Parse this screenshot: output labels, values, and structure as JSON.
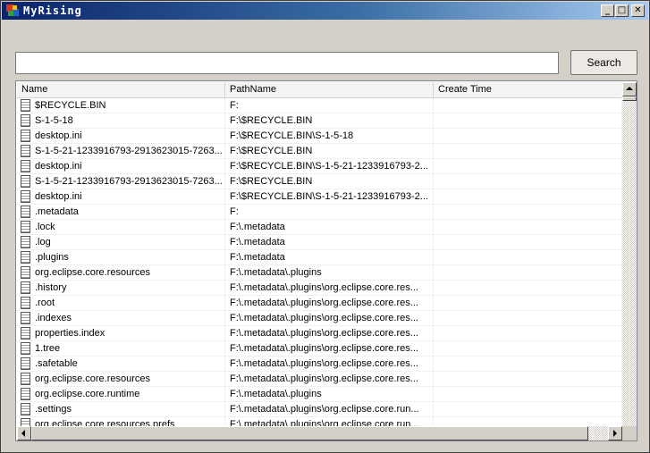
{
  "window": {
    "title": "MyRising",
    "controls": [
      "_",
      "□",
      "✕"
    ]
  },
  "search": {
    "value": "",
    "placeholder": "",
    "button_label": "Search"
  },
  "table": {
    "columns": [
      "Name",
      "PathName",
      "Create Time"
    ],
    "rows": [
      {
        "name": "$RECYCLE.BIN",
        "path": "F:",
        "time": ""
      },
      {
        "name": "S-1-5-18",
        "path": "F:\\$RECYCLE.BIN",
        "time": ""
      },
      {
        "name": "desktop.ini",
        "path": "F:\\$RECYCLE.BIN\\S-1-5-18",
        "time": ""
      },
      {
        "name": "S-1-5-21-1233916793-2913623015-7263...",
        "path": "F:\\$RECYCLE.BIN",
        "time": ""
      },
      {
        "name": "desktop.ini",
        "path": "F:\\$RECYCLE.BIN\\S-1-5-21-1233916793-2...",
        "time": ""
      },
      {
        "name": "S-1-5-21-1233916793-2913623015-7263...",
        "path": "F:\\$RECYCLE.BIN",
        "time": ""
      },
      {
        "name": "desktop.ini",
        "path": "F:\\$RECYCLE.BIN\\S-1-5-21-1233916793-2...",
        "time": ""
      },
      {
        "name": ".metadata",
        "path": "F:",
        "time": ""
      },
      {
        "name": ".lock",
        "path": "F:\\.metadata",
        "time": ""
      },
      {
        "name": ".log",
        "path": "F:\\.metadata",
        "time": ""
      },
      {
        "name": ".plugins",
        "path": "F:\\.metadata",
        "time": ""
      },
      {
        "name": "org.eclipse.core.resources",
        "path": "F:\\.metadata\\.plugins",
        "time": ""
      },
      {
        "name": ".history",
        "path": "F:\\.metadata\\.plugins\\org.eclipse.core.res...",
        "time": ""
      },
      {
        "name": ".root",
        "path": "F:\\.metadata\\.plugins\\org.eclipse.core.res...",
        "time": ""
      },
      {
        "name": ".indexes",
        "path": "F:\\.metadata\\.plugins\\org.eclipse.core.res...",
        "time": ""
      },
      {
        "name": "properties.index",
        "path": "F:\\.metadata\\.plugins\\org.eclipse.core.res...",
        "time": ""
      },
      {
        "name": "1.tree",
        "path": "F:\\.metadata\\.plugins\\org.eclipse.core.res...",
        "time": ""
      },
      {
        "name": ".safetable",
        "path": "F:\\.metadata\\.plugins\\org.eclipse.core.res...",
        "time": ""
      },
      {
        "name": "org.eclipse.core.resources",
        "path": "F:\\.metadata\\.plugins\\org.eclipse.core.res...",
        "time": ""
      },
      {
        "name": "org.eclipse.core.runtime",
        "path": "F:\\.metadata\\.plugins",
        "time": ""
      },
      {
        "name": ".settings",
        "path": "F:\\.metadata\\.plugins\\org.eclipse.core.run...",
        "time": ""
      },
      {
        "name": "org.eclipse.core.resources.prefs",
        "path": "F:\\.metadata\\.plugins\\org.eclipse.core.run...",
        "time": ""
      }
    ]
  },
  "icons": {
    "app": "app-icon",
    "file": "file-icon"
  }
}
